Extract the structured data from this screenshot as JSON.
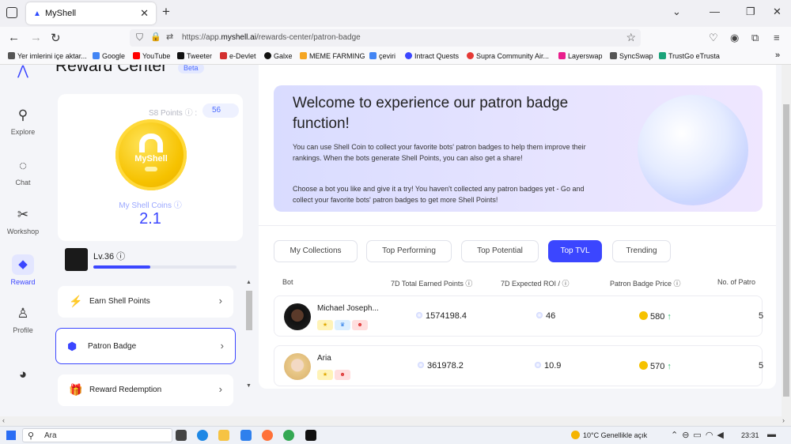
{
  "browser": {
    "tab_title": "MyShell",
    "url_prefix": "https://app.",
    "url_host": "myshell.ai",
    "url_path": "/rewards-center/patron-badge",
    "bookmarks": [
      {
        "label": "Yer imlerini içe aktar...",
        "color": "#555555"
      },
      {
        "label": "Google",
        "color": "#4285f4"
      },
      {
        "label": "YouTube",
        "color": "#ff0000"
      },
      {
        "label": "Tweeter",
        "color": "#111111"
      },
      {
        "label": "e-Devlet",
        "color": "#d32f2f"
      },
      {
        "label": "Galxe",
        "color": "#111111"
      },
      {
        "label": "MEME FARMING",
        "color": "#f5a623"
      },
      {
        "label": "çeviri",
        "color": "#4285f4"
      },
      {
        "label": "Intract Quests",
        "color": "#3b46ff"
      },
      {
        "label": "Supra Community Air...",
        "color": "#e53935"
      },
      {
        "label": "Layerswap",
        "color": "#e91e8c"
      },
      {
        "label": "SyncSwap",
        "color": "#555555"
      },
      {
        "label": "TrustGo eTrusta",
        "color": "#1aa37a"
      }
    ]
  },
  "sidebar": {
    "items": [
      {
        "label": "Explore",
        "icon": "lightbulb-icon",
        "glyph": "💡"
      },
      {
        "label": "Chat",
        "icon": "chat-icon",
        "glyph": "💬"
      },
      {
        "label": "Workshop",
        "icon": "tools-icon",
        "glyph": "✂"
      },
      {
        "label": "Reward",
        "icon": "diamond-icon",
        "glyph": "◆"
      },
      {
        "label": "Profile",
        "icon": "person-icon",
        "glyph": "👤"
      }
    ]
  },
  "header": {
    "title": "Reward Center",
    "badge": "Beta"
  },
  "coin_card": {
    "points_label": "S8 Points ⓘ :",
    "points_value": "56",
    "coin_logo": "MyShell",
    "coins_label": "My Shell Coins ⓘ",
    "coins_value": "2.1"
  },
  "level": {
    "label": "Lv.36 ⓘ",
    "progress": 0.4
  },
  "menu": [
    {
      "label": "Earn Shell Points",
      "icon": "lightning-icon"
    },
    {
      "label": "Patron Badge",
      "icon": "badge-icon"
    },
    {
      "label": "Reward Redemption",
      "icon": "gift-icon"
    }
  ],
  "banner": {
    "title": "Welcome to experience our patron badge function!",
    "paragraph1": "You can use Shell Coin to collect your favorite bots' patron badges to help them improve their rankings. When the bots generate Shell Points, you can also get a share!",
    "paragraph2": "Choose a bot you like and give it a try! You haven't collected any patron badges yet - Go and collect your favorite bots' patron badges to get more Shell Points!"
  },
  "tabs": [
    {
      "label": "My Collections",
      "active": false
    },
    {
      "label": "Top Performing",
      "active": false
    },
    {
      "label": "Top Potential",
      "active": false
    },
    {
      "label": "Top TVL",
      "active": true
    },
    {
      "label": "Trending",
      "active": false
    }
  ],
  "table": {
    "headers": [
      "Bot",
      "7D Total Earned Points ⓘ",
      "7D Expected ROI / ⓘ",
      "Patron Badge Price ⓘ",
      "No. of Patro"
    ],
    "rows": [
      {
        "name": "Michael Joseph...",
        "earned": "1574198.4",
        "roi": "46",
        "price": "580",
        "patrons": "5"
      },
      {
        "name": "Aria",
        "earned": "361978.2",
        "roi": "10.9",
        "price": "570",
        "patrons": "5"
      }
    ]
  },
  "taskbar": {
    "search": "Ara",
    "weather": "10°C  Genellikle açık",
    "time": "23:31"
  }
}
